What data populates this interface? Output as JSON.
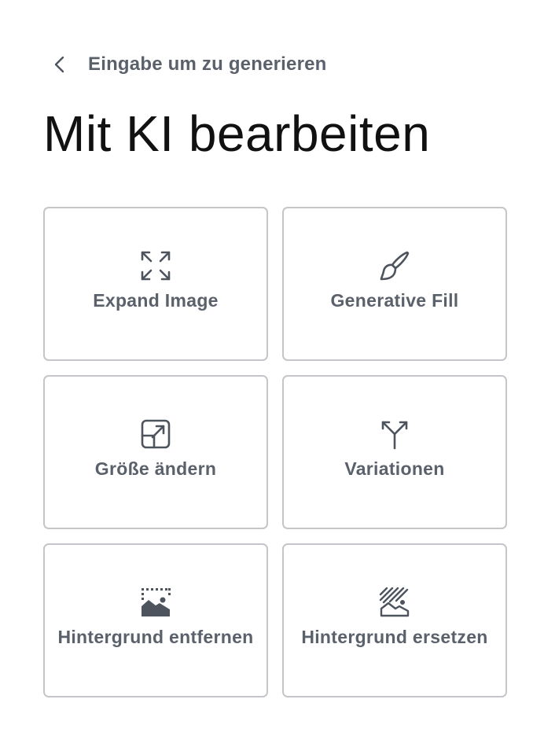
{
  "header": {
    "back_label": "Eingabe um zu generieren",
    "title": "Mit KI bearbeiten"
  },
  "actions": [
    {
      "label": "Expand Image",
      "icon": "expand-arrows-icon"
    },
    {
      "label": "Generative Fill",
      "icon": "paintbrush-icon"
    },
    {
      "label": "Größe ändern",
      "icon": "resize-box-icon"
    },
    {
      "label": "Variationen",
      "icon": "branch-split-icon"
    },
    {
      "label": "Hintergrund entfernen",
      "icon": "remove-background-icon"
    },
    {
      "label": "Hintergrund ersetzen",
      "icon": "replace-background-icon"
    }
  ],
  "colors": {
    "text_primary": "#111111",
    "text_secondary": "#5b616b",
    "card_border": "#c4c6ca",
    "icon": "#4e545e"
  }
}
